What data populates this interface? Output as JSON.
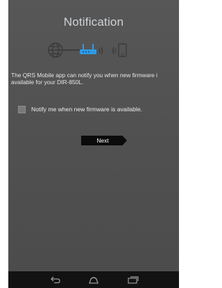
{
  "page": {
    "title": "Notification",
    "description_line1": "The QRS Mobile app can notify you when new firmware i",
    "description_line2": "available for your DIR-850L."
  },
  "notify_checkbox": {
    "label": "Notify me when new firmware is available.",
    "checked": false
  },
  "buttons": {
    "next_label": "Next"
  },
  "icons": {
    "globe": "globe-icon",
    "router": "router-icon",
    "wireless": "wireless-signal-icon",
    "phone": "mobile-phone-icon",
    "nav_back": "back-icon",
    "nav_home": "home-icon",
    "nav_recents": "recent-apps-icon"
  },
  "colors": {
    "background": "#525252",
    "accent": "#2f9ae6",
    "title": "#cfd2d6",
    "button": "#0b0b0b",
    "navbar": "#121212"
  }
}
